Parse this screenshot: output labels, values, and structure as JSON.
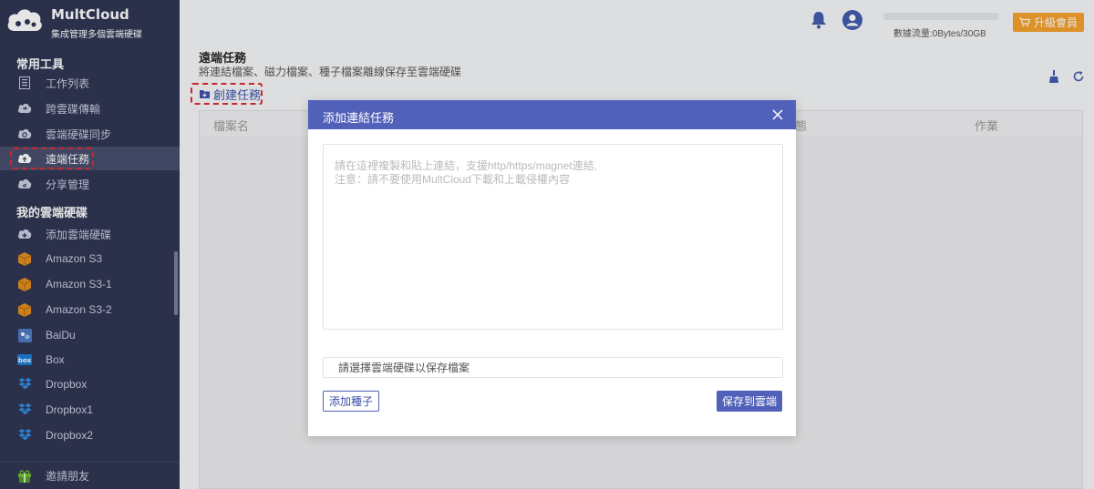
{
  "brand": {
    "name": "MultCloud",
    "tagline": "集成管理多個雲端硬碟"
  },
  "sidebar": {
    "tools_title": "常用工具",
    "tools": [
      {
        "label": "工作列表",
        "icon": "task-list-icon"
      },
      {
        "label": "跨雲碟傳輸",
        "icon": "cloud-transfer-icon"
      },
      {
        "label": "雲端硬碟同步",
        "icon": "cloud-sync-icon"
      },
      {
        "label": "遠端任務",
        "icon": "remote-upload-icon",
        "active": true
      },
      {
        "label": "分享管理",
        "icon": "share-icon"
      }
    ],
    "drives_title": "我的雲端硬碟",
    "drives": [
      {
        "label": "添加雲端硬碟",
        "icon": "add-cloud-icon"
      },
      {
        "label": "Amazon S3",
        "icon": "amazon-s3-icon"
      },
      {
        "label": "Amazon S3-1",
        "icon": "amazon-s3-icon"
      },
      {
        "label": "Amazon S3-2",
        "icon": "amazon-s3-icon"
      },
      {
        "label": "BaiDu",
        "icon": "baidu-icon"
      },
      {
        "label": "Box",
        "icon": "box-icon"
      },
      {
        "label": "Dropbox",
        "icon": "dropbox-icon"
      },
      {
        "label": "Dropbox1",
        "icon": "dropbox-icon"
      },
      {
        "label": "Dropbox2",
        "icon": "dropbox-icon"
      }
    ],
    "footer": {
      "label": "邀請朋友",
      "icon": "gift-icon"
    }
  },
  "header": {
    "traffic": "數據流量:0Bytes/30GB",
    "upgrade_label": "升級會員",
    "icons": [
      "bell-icon",
      "user-icon"
    ]
  },
  "page": {
    "title": "遠端任務",
    "description": "將連結檔案、磁力檔案、種子檔案離線保存至雲端硬碟",
    "create_label": "創建任務",
    "columns": {
      "name": "檔案名",
      "status": "態",
      "action": "作業"
    }
  },
  "modal": {
    "title": "添加連結任務",
    "placeholder_line1": "請在這裡複製和貼上連結，支援http/https/magnet連結,",
    "placeholder_line2": "注意：請不要使用MultCloud下載和上載侵權內容",
    "select_placeholder": "請選擇雲端硬碟以保存檔案",
    "add_torrent_label": "添加種子",
    "save_label": "保存到雲端"
  },
  "colors": {
    "sidebar_bg": "#2c3250",
    "accent": "#5160b8",
    "upgrade": "#f5a029",
    "highlight": "#e0262e"
  }
}
